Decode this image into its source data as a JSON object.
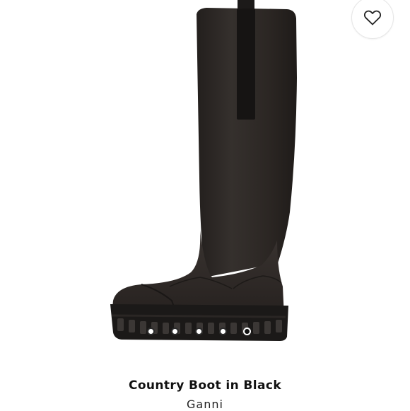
{
  "product": {
    "title": "Country Boot in Black",
    "brand": "Ganni",
    "image_alt": "Country Boot in Black side view"
  },
  "wishlist": {
    "icon": "heart-outline-icon",
    "label": "Add to wishlist"
  },
  "carousel": {
    "total": 5,
    "active_index": 4
  },
  "colors": {
    "boot": "#2e2926",
    "sole": "#1b1918",
    "dot_active": "#111111"
  }
}
